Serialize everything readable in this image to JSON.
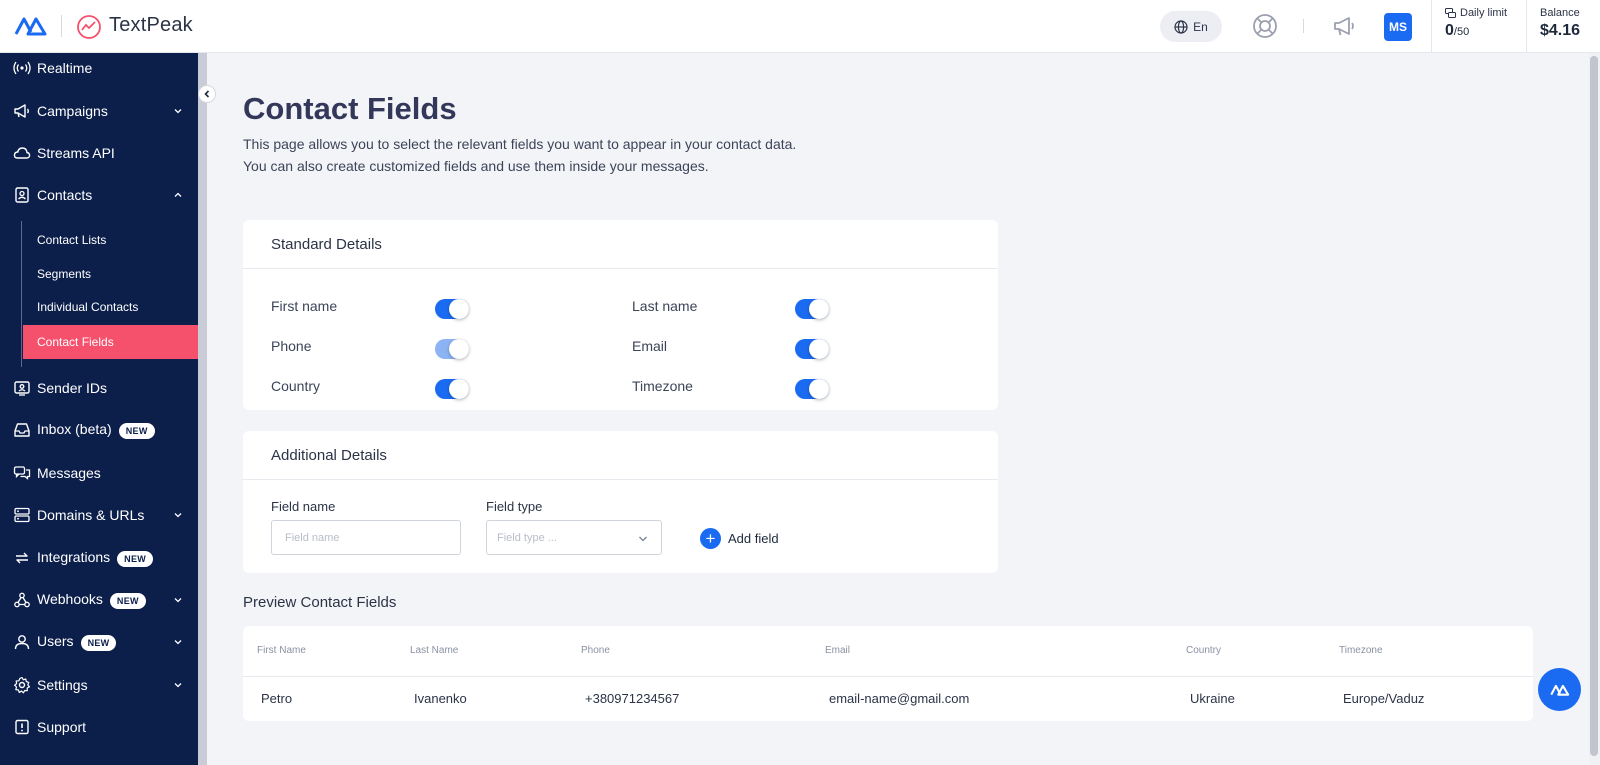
{
  "header": {
    "brand": "TextPeak",
    "language": "En",
    "avatar_initials": "MS",
    "daily_limit_label": "Daily limit",
    "daily_limit_used": "0",
    "daily_limit_total": "/50",
    "balance_label": "Balance",
    "balance_value": "$4.16"
  },
  "sidebar": {
    "items": [
      {
        "label": "Realtime",
        "icon": "broadcast-icon"
      },
      {
        "label": "Campaigns",
        "icon": "megaphone-icon"
      },
      {
        "label": "Streams API",
        "icon": "cloud-icon"
      },
      {
        "label": "Contacts",
        "icon": "contact-book-icon"
      },
      {
        "label": "Sender IDs",
        "icon": "sender-id-icon"
      },
      {
        "label": "Inbox (beta)",
        "icon": "inbox-icon",
        "badge": "NEW"
      },
      {
        "label": "Messages",
        "icon": "chat-icon"
      },
      {
        "label": "Domains & URLs",
        "icon": "server-icon"
      },
      {
        "label": "Integrations",
        "icon": "sync-arrows-icon",
        "badge": "NEW"
      },
      {
        "label": "Webhooks",
        "icon": "webhook-icon",
        "badge": "NEW"
      },
      {
        "label": "Users",
        "icon": "user-icon",
        "badge": "NEW"
      },
      {
        "label": "Settings",
        "icon": "gear-icon"
      },
      {
        "label": "Support",
        "icon": "support-icon"
      }
    ],
    "contacts_sub": [
      "Contact Lists",
      "Segments",
      "Individual Contacts",
      "Contact Fields"
    ]
  },
  "page": {
    "title": "Contact Fields",
    "desc_line1": "This page allows you to select the relevant fields you want to appear in your contact data.",
    "desc_line2": "You can also create customized fields and use them inside your messages."
  },
  "standard": {
    "title": "Standard Details",
    "fields": [
      {
        "label": "First name",
        "on": true
      },
      {
        "label": "Last name",
        "on": true
      },
      {
        "label": "Phone",
        "on": true,
        "disabled": true
      },
      {
        "label": "Email",
        "on": true
      },
      {
        "label": "Country",
        "on": true
      },
      {
        "label": "Timezone",
        "on": true
      }
    ]
  },
  "additional": {
    "title": "Additional Details",
    "field_name_label": "Field name",
    "field_name_placeholder": "Field name",
    "field_type_label": "Field type",
    "field_type_placeholder": "Field type ...",
    "add_label": "Add field"
  },
  "preview": {
    "title": "Preview Contact Fields",
    "headers": [
      "First Name",
      "Last Name",
      "Phone",
      "Email",
      "Country",
      "Timezone"
    ],
    "row": [
      "Petro",
      "Ivanenko",
      "+380971234567",
      "email-name@gmail.com",
      "Ukraine",
      "Europe/Vaduz"
    ]
  },
  "colors": {
    "sidebar_bg": "#0c1e4a",
    "active_item": "#f5506c",
    "accent": "#1b6bf2"
  }
}
